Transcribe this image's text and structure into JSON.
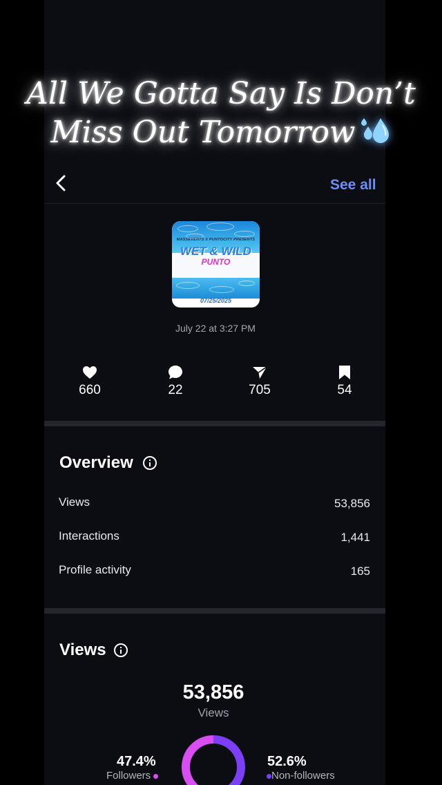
{
  "caption": {
    "line1": "All We Gotta Say Is Don’t",
    "line2": "Miss Out Tomorrow"
  },
  "header": {
    "back_icon": "chevron-left-icon",
    "see_all_label": "See all",
    "accent_color": "#6f8cf7"
  },
  "post": {
    "thumbnail": {
      "presents_text": "MASSEVENTS X PUNTOCITY PRESENTS",
      "title": "WET & WILD",
      "subtitle": "PUNTO",
      "date": "07/25/2025"
    },
    "timestamp": "July 22 at 3:27 PM"
  },
  "stats": [
    {
      "icon": "heart-icon",
      "value": "660"
    },
    {
      "icon": "comment-icon",
      "value": "22"
    },
    {
      "icon": "share-icon",
      "value": "705"
    },
    {
      "icon": "bookmark-icon",
      "value": "54"
    }
  ],
  "overview": {
    "title": "Overview",
    "rows": [
      {
        "label": "Views",
        "value": "53,856"
      },
      {
        "label": "Interactions",
        "value": "1,441"
      },
      {
        "label": "Profile activity",
        "value": "165"
      }
    ]
  },
  "views": {
    "title": "Views",
    "total": "53,856",
    "total_label": "Views",
    "followers": {
      "pct": "47.4%",
      "label": "Followers",
      "fraction": 0.474,
      "color": "#d84ef0"
    },
    "non_followers": {
      "pct": "52.6%",
      "label": "Non-followers",
      "fraction": 0.526,
      "color": "#7b3ff6"
    }
  }
}
